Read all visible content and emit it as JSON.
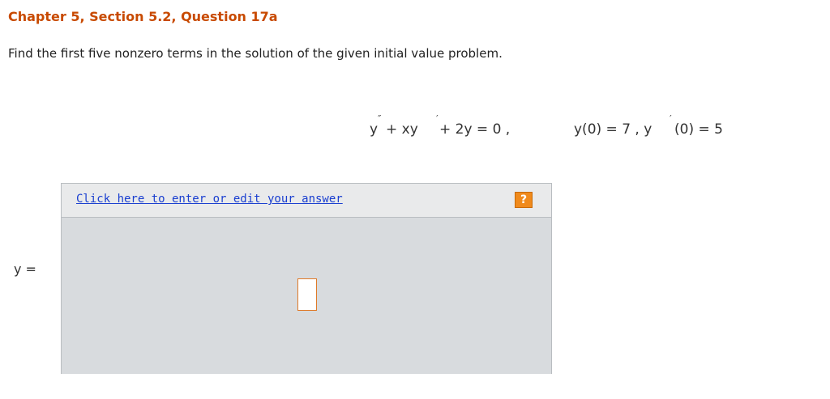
{
  "header": {
    "title": "Chapter 5, Section 5.2, Question 17a"
  },
  "question": {
    "prompt": "Find the first five nonzero terms in the solution of the given initial value problem."
  },
  "equation": {
    "ode_y": "y",
    "ode_y_primes": "″",
    "ode_mid": " + xy",
    "ode_mid_prime": "′",
    "ode_end": " + 2y = 0 ,",
    "ic1": "y(0) = 7 , y",
    "ic2_prime": "′",
    "ic2": "(0) = 5"
  },
  "answer": {
    "link_label": "Click here to enter or edit your answer",
    "help_label": "?",
    "y_label": "y ="
  },
  "colors": {
    "title": "#c84a00",
    "link": "#1a3fd0",
    "help_button": "#f08a1c",
    "answer_area": "#d8dbde"
  }
}
